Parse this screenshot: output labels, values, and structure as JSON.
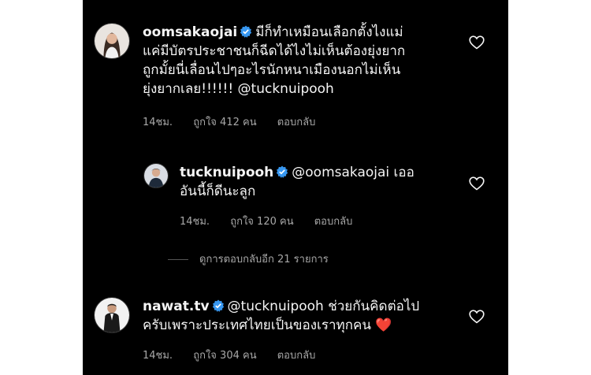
{
  "comments": [
    {
      "username": "oomsakaojai",
      "verified": true,
      "lines": [
        "มีก็ทำเหมือนเลือกตั้งไงแม่",
        "แค่มีบัตรประชาชนก็ฉีดได้ไงไม่เห็นต้องยุ่งยาก",
        "ถูกมั้ยนี่เลื่อนไปๆอะไรนักหนาเมืองนอกไม่เห็น",
        "ยุ่งยากเลย!!!!!! @tucknuipooh"
      ],
      "time": "14ชม.",
      "likes": "ถูกใจ 412 คน",
      "reply": "ตอบกลับ"
    },
    {
      "username": "tucknuipooh",
      "verified": true,
      "lines": [
        "@oomsakaojai เออ",
        "อันนี้ก็ดีนะลูก"
      ],
      "time": "14ชม.",
      "likes": "ถูกใจ 120 คน",
      "reply": "ตอบกลับ"
    },
    {
      "username": "nawat.tv",
      "verified": true,
      "lines": [
        "@tucknuipooh ช่วยกันคิดต่อไป",
        "ครับเพราะประเทศไทยเป็นของเราทุกคน ❤️"
      ],
      "time": "14ชม.",
      "likes": "ถูกใจ 304 คน",
      "reply": "ตอบกลับ"
    }
  ],
  "view_more_replies": "ดูการตอบกลับอีก 21 รายการ",
  "icons": {
    "verified_badge": "verified-badge-icon",
    "like": "heart-outline-icon"
  },
  "colors": {
    "background": "#000000",
    "text": "#f5f5f5",
    "secondary_text": "#a8a8a8",
    "verified": "#3797f0"
  }
}
